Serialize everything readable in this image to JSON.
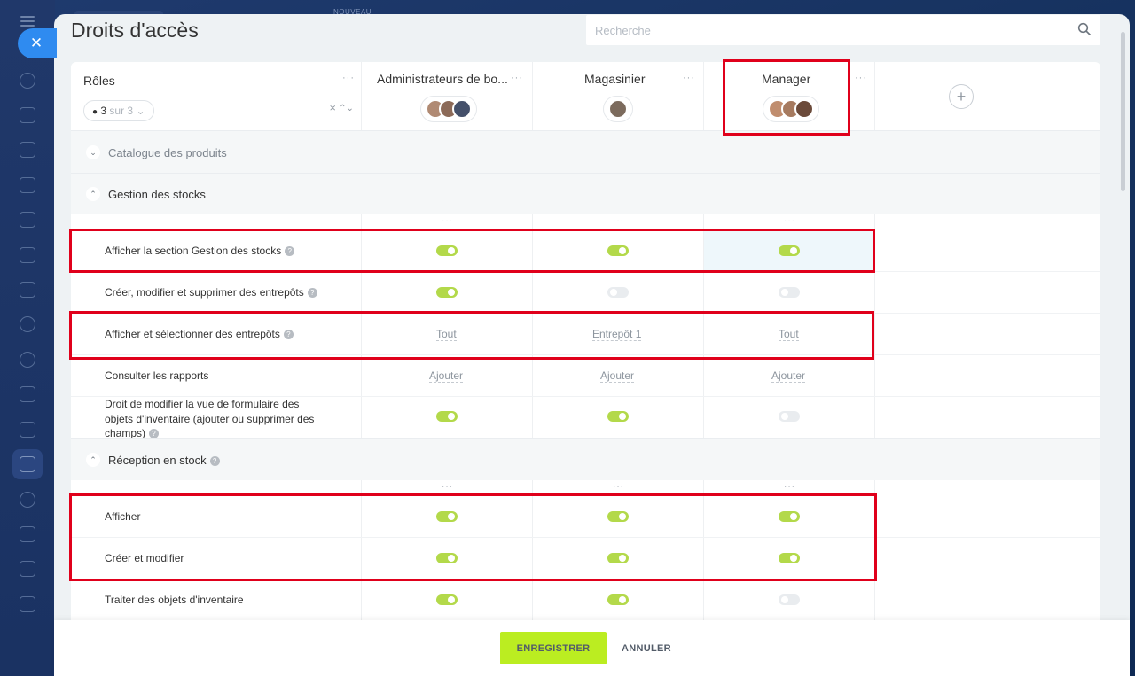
{
  "topbar": {
    "new_badge": "NOUVEAU"
  },
  "page": {
    "title": "Droits d'accès"
  },
  "search": {
    "placeholder": "Recherche"
  },
  "roles_header": {
    "title": "Rôles",
    "shown": "3",
    "total": "sur 3",
    "more": "···"
  },
  "roles": [
    {
      "name": "Administrateurs de bo...",
      "more": "···"
    },
    {
      "name": "Magasinier",
      "more": "···"
    },
    {
      "name": "Manager",
      "more": "···"
    }
  ],
  "add_role": "+",
  "groups": {
    "catalog": {
      "title": "Catalogue des produits",
      "expanded": false
    },
    "stock": {
      "title": "Gestion des stocks",
      "expanded": true
    },
    "reception": {
      "title": "Réception en stock",
      "expanded": true
    }
  },
  "column_more": "···",
  "permissions": {
    "show_section": {
      "label": "Afficher la section Gestion des stocks",
      "values": [
        true,
        true,
        true
      ]
    },
    "manage_warehouses": {
      "label": "Créer, modifier et supprimer des entrepôts",
      "values": [
        true,
        false,
        false
      ]
    },
    "select_warehouses": {
      "label": "Afficher et sélectionner des entrepôts",
      "values": [
        "Tout",
        "Entrepôt 1",
        "Tout"
      ]
    },
    "reports": {
      "label": "Consulter les rapports",
      "values": [
        "Ajouter",
        "Ajouter",
        "Ajouter"
      ]
    },
    "edit_form": {
      "label_l1": "Droit de modifier la vue de formulaire des",
      "label_l2": "objets d'inventaire (ajouter ou supprimer des",
      "label_l3": "champs)",
      "values": [
        true,
        true,
        false
      ]
    },
    "reception_show": {
      "label": "Afficher",
      "values": [
        true,
        true,
        true
      ]
    },
    "reception_edit": {
      "label": "Créer et modifier",
      "values": [
        true,
        true,
        true
      ]
    },
    "process_items": {
      "label": "Traiter des objets d'inventaire",
      "values": [
        true,
        true,
        false
      ]
    }
  },
  "footer": {
    "save": "ENREGISTRER",
    "cancel": "ANNULER"
  },
  "colors": {
    "accent": "#bbed21",
    "toggle_on": "#b3d94a",
    "highlight": "#e0001b",
    "blue": "#2f8bf0"
  }
}
